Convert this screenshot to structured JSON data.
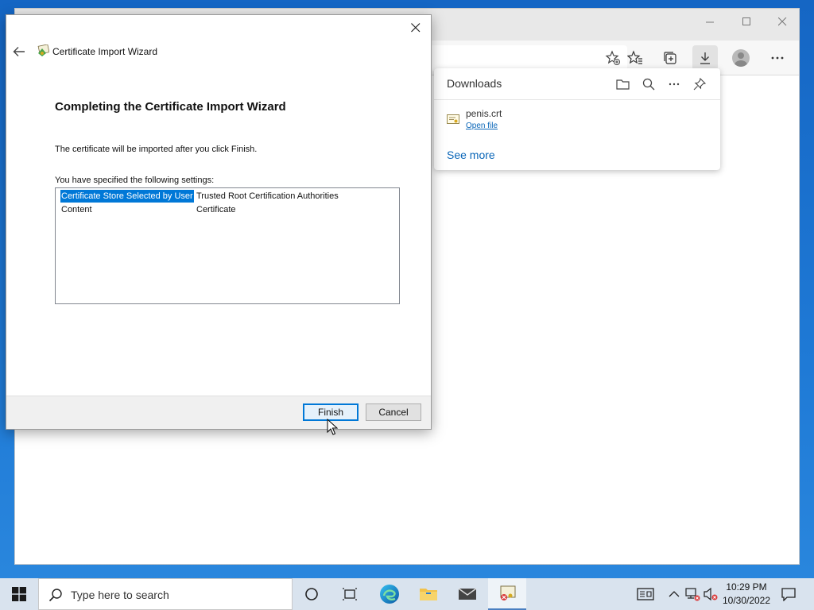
{
  "wizard": {
    "app_title": "Certificate Import Wizard",
    "heading": "Completing the Certificate Import Wizard",
    "info_text": "The certificate will be imported after you click Finish.",
    "settings_label": "You have specified the following settings:",
    "settings": [
      {
        "name": "Certificate Store Selected by User",
        "value": "Trusted Root Certification Authorities",
        "selected": true
      },
      {
        "name": "Content",
        "value": "Certificate",
        "selected": false
      }
    ],
    "finish_label": "Finish",
    "cancel_label": "Cancel"
  },
  "downloads": {
    "title": "Downloads",
    "file_name": "penis.crt",
    "open_file_label": "Open file",
    "see_more_label": "See more"
  },
  "taskbar": {
    "search_placeholder": "Type here to search",
    "time": "10:29 PM",
    "date": "10/30/2022"
  },
  "colors": {
    "accent": "#0078d7",
    "link": "#0a66b8",
    "desktop": "#1a6fc9",
    "taskbar": "#d9e3ee"
  }
}
